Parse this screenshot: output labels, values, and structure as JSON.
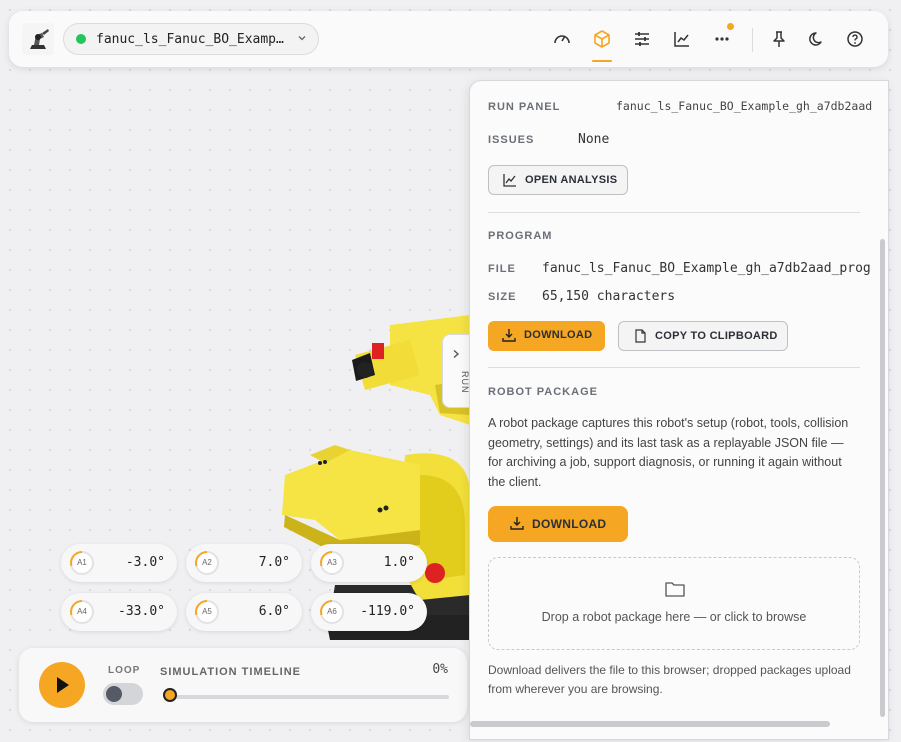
{
  "topbar": {
    "program_name": "fanuc_ls_Fanuc_BO_Examp…",
    "status_color": "#22c55e",
    "icons": [
      "gauge-icon",
      "cube-icon",
      "sliders-icon",
      "chart-icon",
      "more-icon",
      "pin-icon",
      "moon-icon",
      "help-icon"
    ]
  },
  "joints": [
    {
      "label": "A1",
      "value": "-3.0°"
    },
    {
      "label": "A2",
      "value": "7.0°"
    },
    {
      "label": "A3",
      "value": "1.0°"
    },
    {
      "label": "A4",
      "value": "-33.0°"
    },
    {
      "label": "A5",
      "value": "6.0°"
    },
    {
      "label": "A6",
      "value": "-119.0°"
    }
  ],
  "simulation": {
    "loop_label": "LOOP",
    "timeline_label": "SIMULATION TIMELINE",
    "progress_text": "0%",
    "progress": 0
  },
  "run_tab": {
    "label": "RUN"
  },
  "panel": {
    "run_panel_label": "RUN PANEL",
    "run_panel_value": "fanuc_ls_Fanuc_BO_Example_gh_a7db2aad",
    "issues_label": "ISSUES",
    "issues_value": "None",
    "open_analysis": "OPEN ANALYSIS",
    "program_label": "PROGRAM",
    "file_label": "FILE",
    "file_value": "fanuc_ls_Fanuc_BO_Example_gh_a7db2aad_prog",
    "size_label": "SIZE",
    "size_value": "65,150 characters",
    "download": "DOWNLOAD",
    "copy": "COPY TO CLIPBOARD",
    "robot_package_label": "ROBOT PACKAGE",
    "description": "A robot package captures this robot's setup (robot, tools, collision geometry, settings) and its last task as a replayable JSON file — for archiving a job, support diagnosis, or running it again without the client.",
    "package_download": "DOWNLOAD",
    "drop_text": "Drop a robot package here — or click to browse",
    "footer": "Download delivers the file to this browser; dropped packages upload from wherever you are browsing."
  },
  "colors": {
    "accent": "#f5a623",
    "status": "#22c55e"
  }
}
